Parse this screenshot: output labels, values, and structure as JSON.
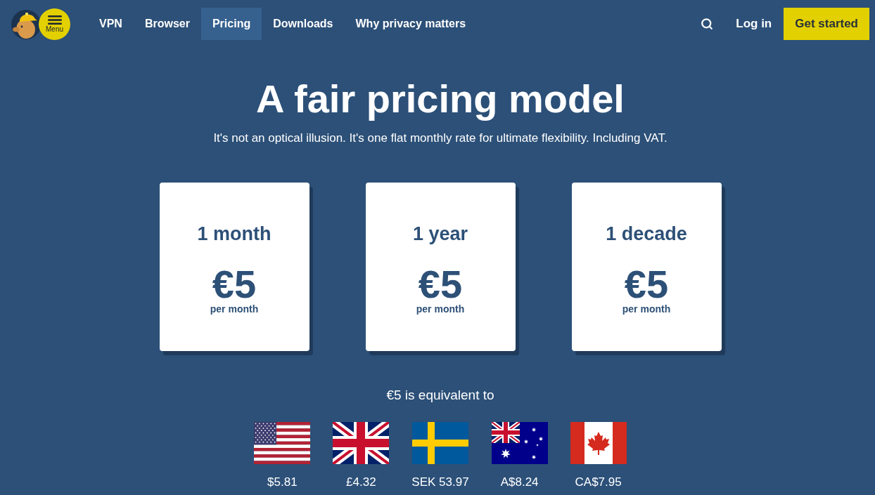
{
  "nav": {
    "menu_button": {
      "label": "Menu"
    },
    "links": [
      {
        "label": "VPN",
        "selected": false
      },
      {
        "label": "Browser",
        "selected": false
      },
      {
        "label": "Pricing",
        "selected": true
      },
      {
        "label": "Downloads",
        "selected": false
      },
      {
        "label": "Why privacy matters",
        "selected": false
      }
    ],
    "login": "Log in",
    "cta": "Get started"
  },
  "hero": {
    "title": "A fair pricing model",
    "subtitle": "It's not an optical illusion. It's one flat monthly rate for ultimate flexibility. Including VAT."
  },
  "plans": [
    {
      "period": "1 month",
      "price": "€5",
      "unit": "per month"
    },
    {
      "period": "1 year",
      "price": "€5",
      "unit": "per month"
    },
    {
      "period": "1 decade",
      "price": "€5",
      "unit": "per month"
    }
  ],
  "equivalents": {
    "heading": "€5 is equivalent to",
    "currencies": [
      {
        "kind": "usa",
        "amount": "$5.81"
      },
      {
        "kind": "uk",
        "amount": "£4.32"
      },
      {
        "kind": "sweden",
        "amount": "SEK 53.97"
      },
      {
        "kind": "australia",
        "amount": "A$8.24"
      },
      {
        "kind": "canada",
        "amount": "CA$7.95"
      }
    ]
  }
}
